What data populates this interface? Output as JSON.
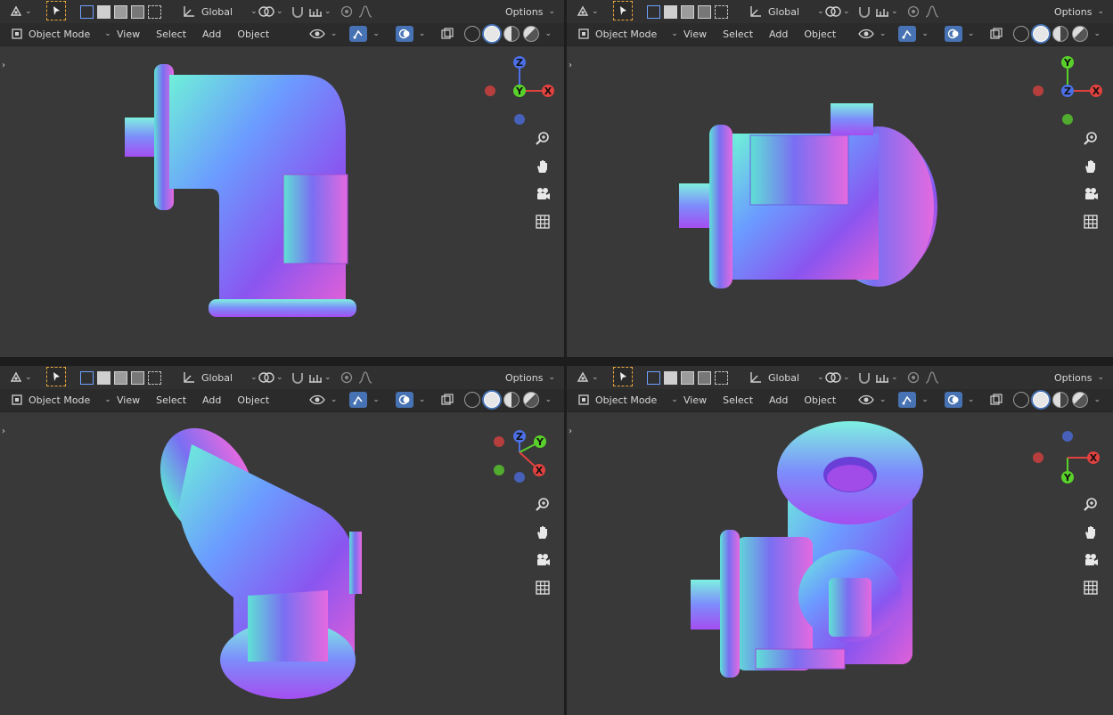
{
  "header": {
    "transform_orientation": "Global",
    "options_label": "Options",
    "mode_label": "Object Mode",
    "menu": [
      "View",
      "Select",
      "Add",
      "Object"
    ]
  },
  "gizmo_axes": {
    "x": "X",
    "y": "Y",
    "z": "Z"
  },
  "colors": {
    "viewport_bg": "#393939",
    "header_bg": "#303030",
    "accent_blue": "#4772b3",
    "axis_x": "#e0423f",
    "axis_y": "#5ad12b",
    "axis_z": "#4c6fe6",
    "select_tool": "#e8a53a"
  },
  "viewports": [
    {
      "name": "top-left",
      "view": "front"
    },
    {
      "name": "top-right",
      "view": "side"
    },
    {
      "name": "bottom-left",
      "view": "perspective"
    },
    {
      "name": "bottom-right",
      "view": "top-perspective"
    }
  ],
  "icons": [
    "editor-type-icon",
    "select-tool-icon",
    "box-select-icon",
    "transform-orientation-icon",
    "snap-icon",
    "proportional-edit-icon",
    "visibility-icon",
    "gizmo-icon",
    "overlay-icon",
    "xray-icon",
    "wireframe-shading-icon",
    "solid-shading-icon",
    "material-shading-icon",
    "rendered-shading-icon",
    "zoom-icon",
    "pan-hand-icon",
    "camera-icon",
    "ortho-grid-icon"
  ]
}
